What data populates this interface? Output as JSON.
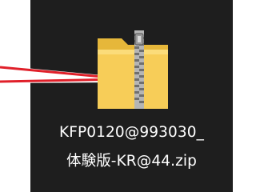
{
  "file": {
    "icon": "zip-folder-icon",
    "name_line1": "KFP0120@993030_",
    "name_line2": "体験版-KR@44.zip"
  },
  "colors": {
    "desktop_background": "#1e1e1e",
    "label_text": "#ffffff",
    "folder_yellow": "#f5c94a",
    "folder_front": "#f9d66a",
    "zipper": "#8f8f8f",
    "pointer_arrow": "#e0202a"
  }
}
